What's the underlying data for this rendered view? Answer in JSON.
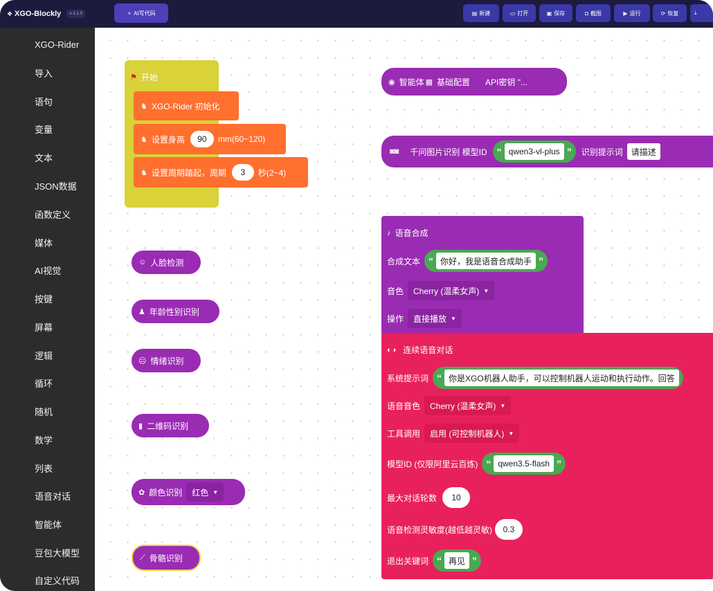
{
  "header": {
    "app_title": "XGO-Blockly",
    "version": "v-1.1.5",
    "ai_button": "AI写代码",
    "buttons": [
      "新建",
      "打开",
      "保存",
      "截图",
      "运行",
      "恢复"
    ]
  },
  "sidebar": {
    "categories": [
      {
        "label": "XGO-Rider",
        "color": "#2c2c2c"
      },
      {
        "label": "导入",
        "color": "#2c2c2c"
      },
      {
        "label": "语句",
        "color": "#2c2c2c"
      },
      {
        "label": "变量",
        "color": "#2c2c2c"
      },
      {
        "label": "文本",
        "color": "#2c2c2c"
      },
      {
        "label": "JSON数据",
        "color": "#2c2c2c"
      },
      {
        "label": "函数定义",
        "color": "#2c2c2c"
      },
      {
        "label": "媒体",
        "color": "#2c2c2c"
      },
      {
        "label": "AI视觉",
        "color": "#2c2c2c"
      },
      {
        "label": "按键",
        "color": "#2c2c2c"
      },
      {
        "label": "屏幕",
        "color": "#2c2c2c"
      },
      {
        "label": "逻辑",
        "color": "#2c2c2c"
      },
      {
        "label": "循环",
        "color": "#2c2c2c"
      },
      {
        "label": "随机",
        "color": "#2c2c2c"
      },
      {
        "label": "数学",
        "color": "#2c2c2c"
      },
      {
        "label": "列表",
        "color": "#2c2c2c"
      },
      {
        "label": "语音对话",
        "color": "#2c2c2c"
      },
      {
        "label": "智能体",
        "color": "#2c2c2c"
      },
      {
        "label": "豆包大模型",
        "color": "#2c2c2c"
      },
      {
        "label": "自定义代码",
        "color": "#2c2c2c"
      }
    ]
  },
  "blocks": {
    "start": {
      "label": "开始"
    },
    "init": {
      "label": "XGO-Rider 初始化"
    },
    "height": {
      "label": "设置身高",
      "value": "90",
      "unit": "mm(60~120)"
    },
    "stepping": {
      "label": "设置周期踏起，周期",
      "value": "3",
      "unit": "秒(2~4)"
    },
    "face": {
      "label": "人脸检测"
    },
    "age": {
      "label": "年龄性别识别"
    },
    "emotion": {
      "label": "情绪识别"
    },
    "qrcode": {
      "label": "二维码识别"
    },
    "color": {
      "label": "颜色识别",
      "option": "红色"
    },
    "skeleton": {
      "label": "骨骼识别"
    },
    "agent": {
      "prefix": "智能体",
      "label": "基础配置",
      "api_label": "API密钥 \"..."
    },
    "qwen_image": {
      "label": "千问图片识别  模型ID",
      "model": "qwen3-vl-plus",
      "prompt_label": "识别提示词",
      "prompt_value": "请描述"
    },
    "tts": {
      "title": "语音合成",
      "text_label": "合成文本",
      "text_value": "你好，我是语音合成助手",
      "voice_label": "音色",
      "voice_value": "Cherry (温柔女声)",
      "op_label": "操作",
      "op_value": "直接播放"
    },
    "dialog": {
      "title": "连续语音对话",
      "sys_label": "系统提示词",
      "sys_value": "你是XGO机器人助手，可以控制机器人运动和执行动作。回答",
      "voice_label": "语音音色",
      "voice_value": "Cherry (温柔女声)",
      "tool_label": "工具调用",
      "tool_value": "启用 (可控制机器人)",
      "model_label": "模型ID (仅限阿里云百炼)",
      "model_value": "qwen3.5-flash",
      "rounds_label": "最大对话轮数",
      "rounds_value": "10",
      "sens_label": "语音检测灵敏度(越低越灵敏)",
      "sens_value": "0.3",
      "exit_label": "退出关键词",
      "exit_value": "再见"
    }
  },
  "colors": {
    "topbar": "#1c1a3d",
    "sidebar": "#2c2c2c",
    "hat": "#d9d238",
    "orange": "#ff6f2e",
    "purple": "#9a2bb3",
    "magenta": "#e8215c",
    "string_green": "#4aa852"
  }
}
